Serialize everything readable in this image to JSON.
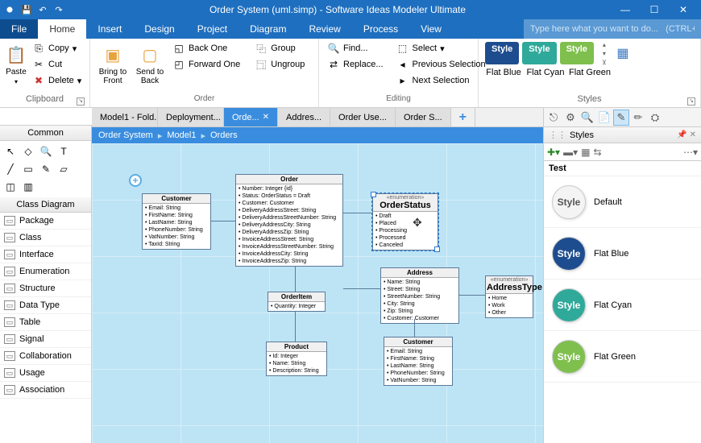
{
  "title": "Order System (uml.simp) - Software Ideas Modeler Ultimate",
  "menu": {
    "file": "File",
    "items": [
      "Home",
      "Insert",
      "Design",
      "Project",
      "Diagram",
      "Review",
      "Process",
      "View"
    ],
    "search_placeholder": "Type here what you want to do...   (CTRL+Q)"
  },
  "ribbon": {
    "clipboard": {
      "label": "Clipboard",
      "paste": "Paste",
      "copy": "Copy",
      "cut": "Cut",
      "delete": "Delete"
    },
    "order": {
      "label": "Order",
      "front": "Bring to Front",
      "back": "Send to Back",
      "backone": "Back One",
      "fwdone": "Forward One",
      "group": "Group",
      "ungroup": "Ungroup"
    },
    "editing": {
      "label": "Editing",
      "find": "Find...",
      "replace": "Replace...",
      "select": "Select",
      "prev": "Previous Selection",
      "next": "Next Selection"
    },
    "styles": {
      "label": "Styles",
      "chip": "Style",
      "flatblue": "Flat Blue",
      "flatcyan": "Flat Cyan",
      "flatgreen": "Flat Green"
    }
  },
  "left": {
    "common": "Common",
    "classdiag": "Class Diagram",
    "items": [
      "Package",
      "Class",
      "Interface",
      "Enumeration",
      "Structure",
      "Data Type",
      "Table",
      "Signal",
      "Collaboration",
      "Usage",
      "Association"
    ]
  },
  "tabs": [
    "Model1 - Fold...",
    "Deployment...",
    "Orde...",
    "Addres...",
    "Order Use...",
    "Order S..."
  ],
  "activeTab": 2,
  "breadcrumb": [
    "Order System",
    "Model1",
    "Orders"
  ],
  "uml": {
    "customer": {
      "title": "Customer",
      "attrs": [
        "Email: String",
        "FirstName: String",
        "LastName: String",
        "PhoneNumber: String",
        "VatNumber: String",
        "TaxId: String"
      ]
    },
    "order": {
      "title": "Order",
      "attrs": [
        "Number: Integer {id}",
        "Status: OrderStatus = Draft",
        "Customer: Customer",
        "DeliveryAddressStreet: String",
        "DeliveryAddressStreetNumber: String",
        "DeliveryAddressCity: String",
        "DeliveryAddressZip: String",
        "InvoiceAddressStreet: String",
        "InvoiceAddressStreetNumber: String",
        "InvoiceAddressCity: String",
        "InvoiceAddressZip: String"
      ]
    },
    "orderstatus": {
      "stereo": "«enumeration»",
      "title": "OrderStatus",
      "attrs": [
        "Draft",
        "Placed",
        "Processing",
        "Processed",
        "Canceled"
      ]
    },
    "address": {
      "title": "Address",
      "attrs": [
        "Name: String",
        "Street: String",
        "StreetNumber: String",
        "City: String",
        "Zip: String",
        "Customer: Customer"
      ]
    },
    "addresstype": {
      "stereo": "«enumeration»",
      "title": "AddressType",
      "attrs": [
        "Home",
        "Work",
        "Other"
      ]
    },
    "orderitem": {
      "title": "OrderItem",
      "attrs": [
        "Quantity: Integer"
      ]
    },
    "product": {
      "title": "Product",
      "attrs": [
        "Id: Integer",
        "Name: String",
        "Description: String"
      ]
    },
    "customer2": {
      "title": "Customer",
      "attrs": [
        "Email: String",
        "FirstName: String",
        "LastName: String",
        "PhoneNumber: String",
        "VatNumber: String"
      ]
    }
  },
  "right": {
    "header": "Styles",
    "sub": "Test",
    "items": [
      {
        "label": "Default",
        "bg": "#f4f4f4",
        "fg": "#555"
      },
      {
        "label": "Flat Blue",
        "bg": "#1e4d8f",
        "fg": "#fff"
      },
      {
        "label": "Flat Cyan",
        "bg": "#2fa99a",
        "fg": "#fff"
      },
      {
        "label": "Flat Green",
        "bg": "#7fbf4d",
        "fg": "#fff"
      }
    ]
  }
}
